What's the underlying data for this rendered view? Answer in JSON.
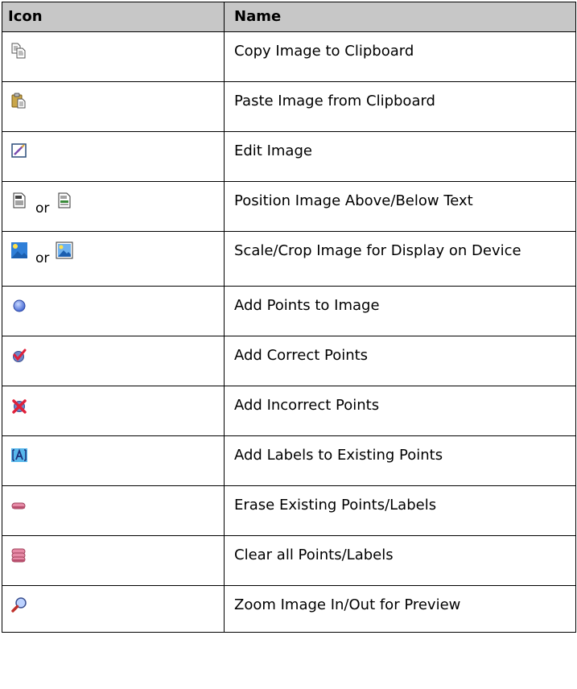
{
  "header": {
    "icon": "Icon",
    "name": "Name"
  },
  "or_text": "or",
  "rows": [
    {
      "name": "Copy Image to Clipboard",
      "icon": "copy-icon"
    },
    {
      "name": "Paste Image from Clipboard",
      "icon": "paste-icon"
    },
    {
      "name": "Edit Image",
      "icon": "edit-image-icon"
    },
    {
      "name": "Position Image Above/Below Text",
      "icon": "position-image-icon"
    },
    {
      "name": "Scale/Crop Image for Display on Device",
      "icon": "scale-crop-icon"
    },
    {
      "name": "Add Points to Image",
      "icon": "blue-dot-icon"
    },
    {
      "name": "Add Correct Points",
      "icon": "correct-check-icon"
    },
    {
      "name": "Add Incorrect Points",
      "icon": "incorrect-x-icon"
    },
    {
      "name": "Add Labels to Existing Points",
      "icon": "label-a-icon"
    },
    {
      "name": "Erase Existing Points/Labels",
      "icon": "eraser-icon"
    },
    {
      "name": "Clear all Points/Labels",
      "icon": "clear-all-icon"
    },
    {
      "name": "Zoom Image In/Out for Preview",
      "icon": "zoom-magnifier-icon"
    }
  ],
  "colors": {
    "header_bg": "#c7c7c7",
    "border": "#000000"
  }
}
